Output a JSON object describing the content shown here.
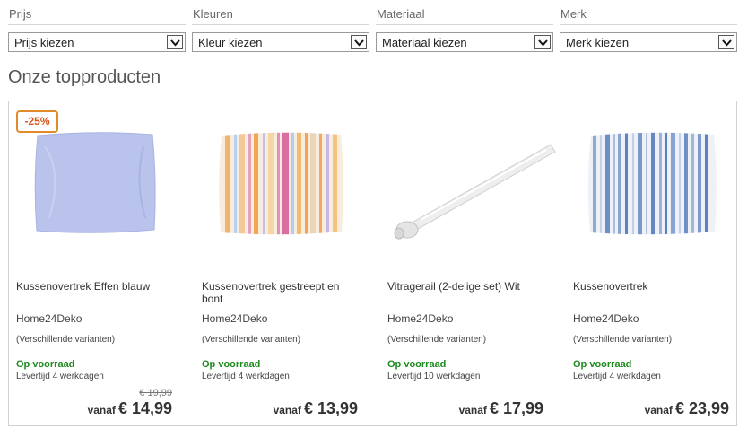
{
  "filters": [
    {
      "label": "Prijs",
      "value": "Prijs kiezen"
    },
    {
      "label": "Kleuren",
      "value": "Kleur kiezen"
    },
    {
      "label": "Materiaal",
      "value": "Materiaal kiezen"
    },
    {
      "label": "Merk",
      "value": "Merk kiezen"
    }
  ],
  "section_title": "Onze topproducten",
  "products": [
    {
      "badge": "-25%",
      "name": "Kussenovertrek Effen blauw",
      "brand": "Home24Deko",
      "variants": "(Verschillende varianten)",
      "stock": "Op voorraad",
      "delivery": "Levertijd 4 werkdagen",
      "old_price": "€ 19,99",
      "from": "vanaf",
      "price": "€ 14,99"
    },
    {
      "name": "Kussenovertrek gestreept en bont",
      "brand": "Home24Deko",
      "variants": "(Verschillende varianten)",
      "stock": "Op voorraad",
      "delivery": "Levertijd 4 werkdagen",
      "from": "vanaf",
      "price": "€ 13,99"
    },
    {
      "name": "Vitragerail (2-delige set) Wit",
      "brand": "Home24Deko",
      "variants": "(Verschillende varianten)",
      "stock": "Op voorraad",
      "delivery": "Levertijd 10 werkdagen",
      "from": "vanaf",
      "price": "€ 17,99"
    },
    {
      "name": "Kussenovertrek",
      "brand": "Home24Deko",
      "variants": "(Verschillende varianten)",
      "stock": "Op voorraad",
      "delivery": "Levertijd 4 werkdagen",
      "from": "vanaf",
      "price": "€ 23,99"
    }
  ],
  "colors": {
    "badge_border": "#e08a2a",
    "badge_text": "#d9541e",
    "stock_green": "#1f8a1f",
    "pillow_blue": "#b9c3ec"
  },
  "icons": {
    "select_arrow": "chevron-down-icon"
  }
}
